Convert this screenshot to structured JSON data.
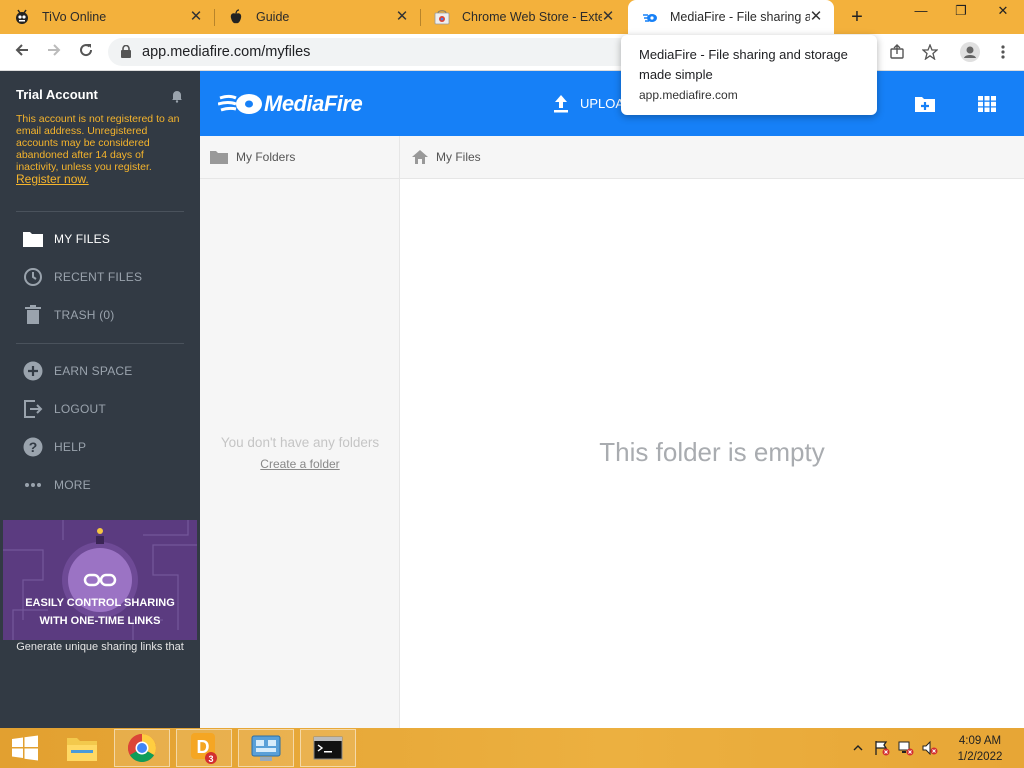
{
  "browser": {
    "tabs": [
      {
        "title": "TiVo Online",
        "icon": "tivo-icon"
      },
      {
        "title": "Guide",
        "icon": "apple-icon"
      },
      {
        "title": "Chrome Web Store - Exten",
        "icon": "chrome-web-store-icon"
      },
      {
        "title": "MediaFire - File sharing an",
        "icon": "mediafire-icon",
        "active": true
      }
    ],
    "url": "app.mediafire.com/myfiles",
    "tooltip": {
      "title": "MediaFire - File sharing and storage made simple",
      "url": "app.mediafire.com"
    }
  },
  "sidebar": {
    "account_title": "Trial Account",
    "note": "This account is not registered to an email address. Unregistered accounts may be considered abandoned after 14 days of inactivity, unless you register.",
    "register_link": "Register now.",
    "nav_primary": [
      {
        "label": "MY FILES",
        "icon": "folder-icon",
        "active": true
      },
      {
        "label": "RECENT FILES",
        "icon": "clock-icon"
      },
      {
        "label": "TRASH (0)",
        "icon": "trash-icon"
      }
    ],
    "nav_secondary": [
      {
        "label": "EARN SPACE",
        "icon": "plus-circle-icon"
      },
      {
        "label": "LOGOUT",
        "icon": "logout-icon"
      },
      {
        "label": "HELP",
        "icon": "help-icon"
      },
      {
        "label": "MORE",
        "icon": "more-dots-icon"
      }
    ],
    "promo": {
      "title_line1": "EASILY CONTROL SHARING",
      "title_line2": "WITH ONE-TIME LINKS",
      "text": "Generate unique sharing links that"
    }
  },
  "header": {
    "logo_text": "MediaFire",
    "upload_label": "UPLOA"
  },
  "folders_panel": {
    "title": "My Folders",
    "empty_text": "You don't have any folders",
    "create_link": "Create a folder"
  },
  "files_panel": {
    "breadcrumb": "My Files",
    "empty_text": "This folder is empty"
  },
  "taskbar": {
    "time": "4:09 AM",
    "date": "1/2/2022",
    "badge_count": "3"
  },
  "colors": {
    "tabstrip": "#f3b13c",
    "sidebar": "#323a44",
    "brand_blue": "#1680f7",
    "warning": "#f5b42c"
  }
}
